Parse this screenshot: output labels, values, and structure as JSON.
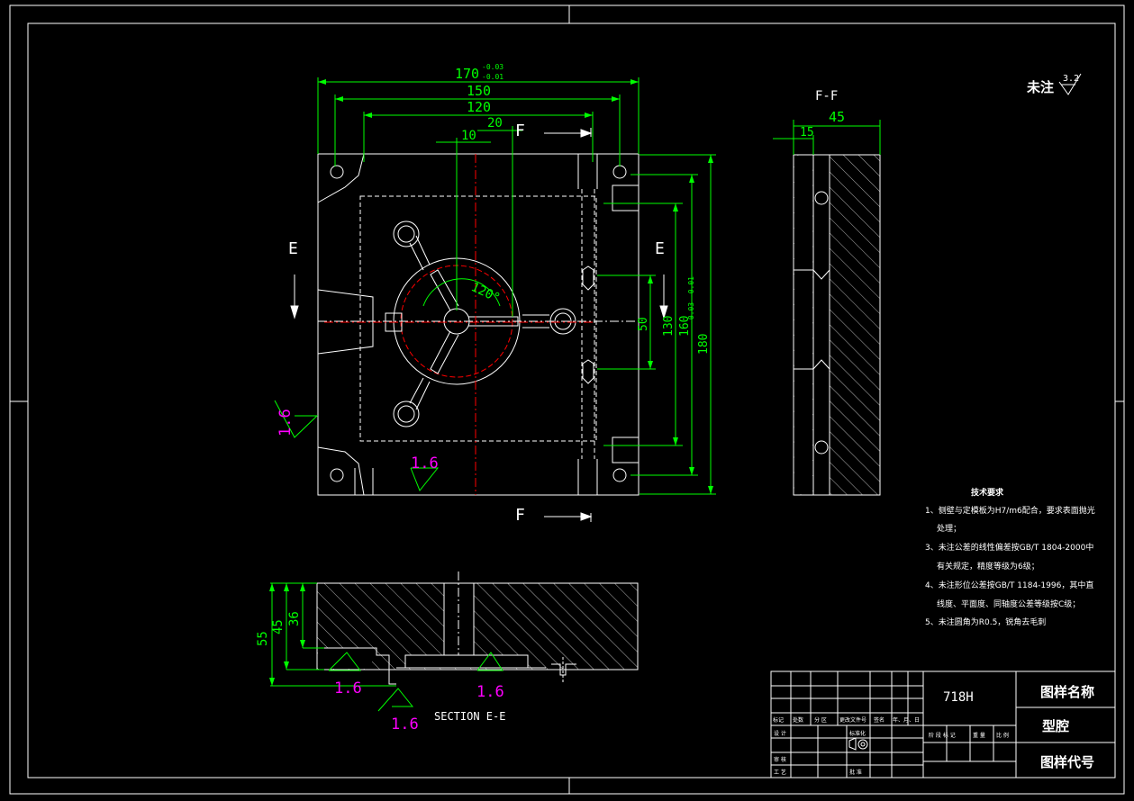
{
  "colors": {
    "background": "#000000",
    "outline": "#ffffff",
    "dimension": "#00ff00",
    "roughness": "#ff00ff",
    "centerline": "#ff0000",
    "leader": "#00ffff"
  },
  "roughness_note": {
    "label": "未注",
    "value": "3.2"
  },
  "views": {
    "section_ff": "F-F",
    "section_ee": "SECTION E-E",
    "cut_f": "F",
    "cut_e": "E"
  },
  "dimensions": {
    "top_overall": "170",
    "top_overall_tol_upper": "-0.03",
    "top_overall_tol_lower": "-0.01",
    "top_150": "150",
    "top_120": "120",
    "top_20": "20",
    "top_10": "10",
    "angle": "120°",
    "right_50": "50",
    "right_130": "130",
    "right_160": "160",
    "right_180": "180",
    "right_180_tol": "-0.03 -0.01",
    "side_45": "45",
    "side_15": "15",
    "low_55": "55",
    "low_45": "45",
    "low_36": "36",
    "rough_1": "1.6",
    "rough_2": "1.6",
    "rough_3": "1.6",
    "rough_4": "1.6",
    "rough_5": "1.6"
  },
  "tech_requirements": {
    "title": "技术要求",
    "lines": [
      "1、侧壁与定模板为H7/m6配合，要求表面抛光",
      "处理；",
      "3、未注公差的线性偏差按GB/T 1804-2000中",
      "有关规定，精度等级为6级；",
      "4、未注形位公差按GB/T 1184-1996，其中直",
      "线度、平面度、同轴度公差等级按C级；",
      "5、未注圆角为R0.5，锐角去毛刺"
    ]
  },
  "title_block": {
    "material": "718H",
    "drawing_name_label": "图样名称",
    "part_name": "型腔",
    "drawing_code_label": "图样代号",
    "hdr_labels": [
      "标记",
      "处数",
      "分 区",
      "更改文件号",
      "签名",
      "年、月、日"
    ],
    "row_labels": [
      "设 计",
      "标准化",
      "审 核",
      "工 艺",
      "批 准"
    ],
    "stage_labels": [
      "阶 段 标 记",
      "重 量",
      "比 例"
    ]
  }
}
